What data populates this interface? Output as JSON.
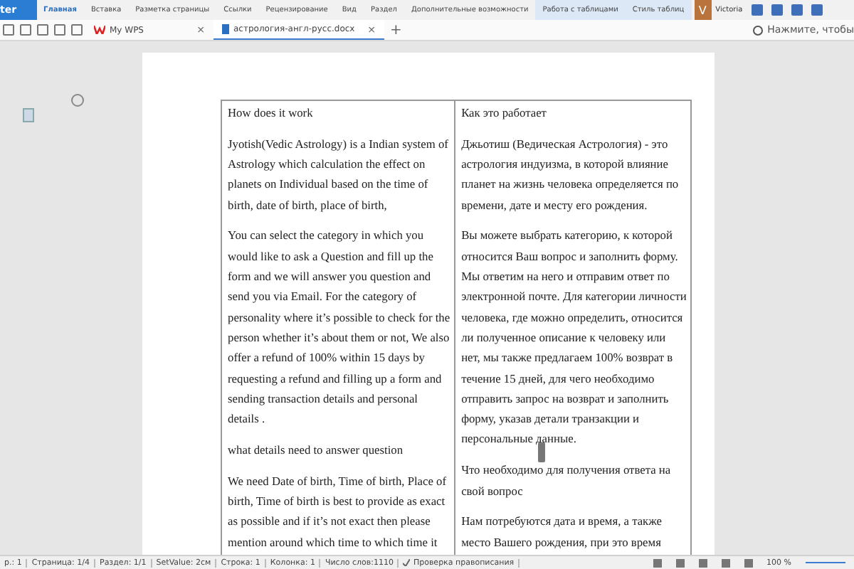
{
  "ribbon": {
    "app_button": "ter",
    "tabs": [
      {
        "label": "Главная",
        "selected": true,
        "kind": "normal"
      },
      {
        "label": "Вставка",
        "selected": false,
        "kind": "normal"
      },
      {
        "label": "Разметка страницы",
        "selected": false,
        "kind": "normal"
      },
      {
        "label": "Ссылки",
        "selected": false,
        "kind": "normal"
      },
      {
        "label": "Рецензирование",
        "selected": false,
        "kind": "normal"
      },
      {
        "label": "Вид",
        "selected": false,
        "kind": "normal"
      },
      {
        "label": "Раздел",
        "selected": false,
        "kind": "normal"
      },
      {
        "label": "Дополнительные возможности",
        "selected": false,
        "kind": "normal"
      },
      {
        "label": "Работа с таблицами",
        "selected": false,
        "kind": "context"
      },
      {
        "label": "Стиль таблиц",
        "selected": false,
        "kind": "context"
      }
    ],
    "user": {
      "initial": "V",
      "name": "Victoria"
    }
  },
  "doc_tabs": [
    {
      "label": "My WPS",
      "selected": false,
      "kind": "home",
      "close": "×"
    },
    {
      "label": "астрология-англ-русс.docx",
      "selected": true,
      "kind": "doc",
      "close": "×"
    }
  ],
  "new_tab": "+",
  "search": {
    "placeholder": "Нажмите, чтобы"
  },
  "table": {
    "cells": [
      {
        "paragraphs": [
          {
            "lines": [
              "How does it work"
            ]
          },
          {
            "lines": [
              "Jyotish(Vedic Astrology)  is a Indian system of",
              "Astrology which calculation the effect on",
              "planets on Individual based on the time of",
              "birth, date of birth, place of birth,"
            ]
          },
          {
            "lines": [
              "You can select the category in which you",
              "would like to ask a Question and fill up the",
              "form and we will answer you question and",
              "send you via Email. For the category of",
              "personality where it’s possible to check for the",
              "person whether it’s about them or not, We also",
              "offer a refund of 100% within 15 days by",
              "requesting a refund and filling up a form and",
              "sending transaction details and personal",
              "details ."
            ]
          },
          {
            "lines": [
              "what details need to answer question"
            ]
          },
          {
            "lines": [
              "We need Date of birth, Time of birth, Place of",
              "birth, Time of birth is best to provide as exact",
              "as possible and if it’s not exact then please",
              "mention around which time to which time it"
            ]
          }
        ]
      },
      {
        "paragraphs": [
          {
            "lines": [
              "Как это работает"
            ]
          },
          {
            "lines": [
              "Джьотиш (Ведическая Астрология) - это",
              "астрология индуизма, в которой влияние",
              "планет на жизнь человека определяется по",
              "времени, дате и месту его рождения."
            ]
          },
          {
            "lines": [
              "Вы можете выбрать категорию, к которой",
              "относится Ваш вопрос и заполнить форму.",
              "Мы ответим на него и отправим ответ по",
              "электронной почте. Для категории личности",
              "человека, где можно определить, относится",
              "ли полученное описание к человеку или",
              "нет, мы также предлагаем 100% возврат в",
              "течение 15 дней, для чего необходимо",
              "отправить запрос на возврат и заполнить",
              "форму, указав детали транзакции и",
              "персональные данные."
            ]
          },
          {
            "lines": [
              "Что необходимо для получения ответа на",
              "свой вопрос"
            ]
          },
          {
            "lines": [
              "Нам потребуются дата и время, а также",
              "место Вашего рождения, при это время"
            ]
          }
        ]
      }
    ]
  },
  "status_bar": {
    "items": [
      {
        "text": "р.: 1",
        "kind": "text"
      },
      {
        "text": "Страница: 1/4",
        "kind": "text"
      },
      {
        "text": "Раздел: 1/1",
        "kind": "text"
      },
      {
        "text": "SetValue: 2см",
        "kind": "text"
      },
      {
        "text": "Строка: 1",
        "kind": "text"
      },
      {
        "text": "Колонка: 1",
        "kind": "text"
      },
      {
        "text": "Число слов:1110",
        "kind": "text"
      },
      {
        "text": "Проверка правописания",
        "kind": "spellcheck"
      }
    ],
    "zoom": "100 %"
  }
}
